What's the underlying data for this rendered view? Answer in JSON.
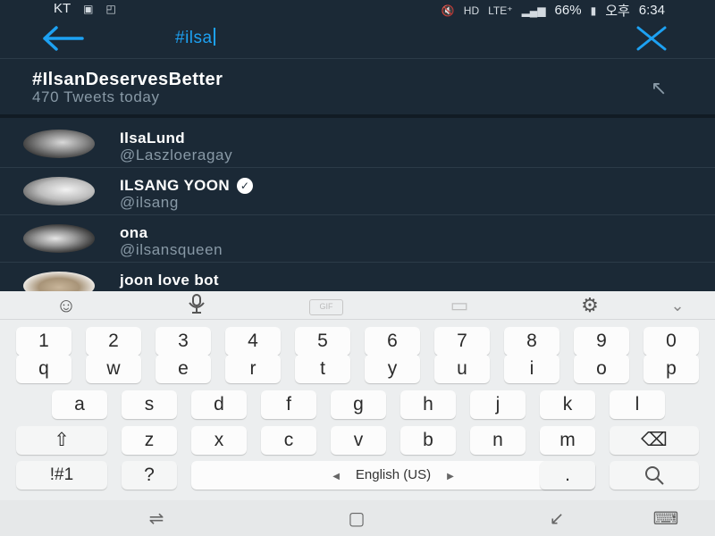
{
  "status_bar": {
    "carrier": "KT",
    "left_icons": [
      "talk-icon",
      "screenshot-icon"
    ],
    "right_icons": [
      "mute-icon",
      "hd-icon",
      "lte-icon",
      "signal-icon"
    ],
    "hd": "HD",
    "lte": "LTE⁺",
    "battery": "66%",
    "ampm": "오후",
    "time": "6:34"
  },
  "search": {
    "query": "#ilsa",
    "back_icon": "arrow-left-icon",
    "clear_icon": "close-icon",
    "accent": "#1da1f2"
  },
  "trend": {
    "hashtag": "#IlsanDeservesBetter",
    "count_text": "470 Tweets today"
  },
  "users": [
    {
      "name": "IlsaLund",
      "handle": "@Laszloeragay",
      "verified": false
    },
    {
      "name": "ILSANG YOON",
      "handle": "@ilsang",
      "verified": true
    },
    {
      "name": "ona",
      "handle": "@ilsansqueen",
      "verified": false
    },
    {
      "name": "joon love bot",
      "handle": "",
      "verified": false
    }
  ],
  "keyboard": {
    "toolbar": {
      "gif": "GIF"
    },
    "numbers": [
      "1",
      "2",
      "3",
      "4",
      "5",
      "6",
      "7",
      "8",
      "9",
      "0"
    ],
    "row1": [
      "q",
      "w",
      "e",
      "r",
      "t",
      "y",
      "u",
      "i",
      "o",
      "p"
    ],
    "row2": [
      "a",
      "s",
      "d",
      "f",
      "g",
      "h",
      "j",
      "k",
      "l"
    ],
    "row3": [
      "z",
      "x",
      "c",
      "v",
      "b",
      "n",
      "m"
    ],
    "sym_key": "!#1",
    "question_key": "?",
    "space_label": "English (US)",
    "period_key": "."
  },
  "colors": {
    "background": "#1b2936",
    "text_primary": "#ffffff",
    "text_secondary": "#8899a6"
  }
}
